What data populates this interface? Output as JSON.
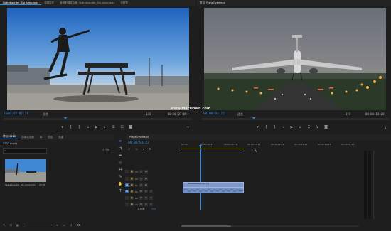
{
  "source_monitor": {
    "tabs": [
      "Skateboarder_Big_Jump.mov",
      "效果控件",
      "音频剪辑混合器: Skateboarder_Big_Jump.mov",
      "元数据"
    ],
    "timecode_left": "1&nbsp;00:02:01:28",
    "timecode_left_text": "1&00:02:01:28",
    "fit": "适合",
    "fraction": "1/2",
    "timecode_right": "00:00:27:08"
  },
  "program_monitor": {
    "tab": "节目: PlaneOverhead",
    "timecode_left": "00:00:03:22",
    "fit": "适合",
    "fraction": "1/2",
    "timecode_right": "00:00:12:20",
    "watermark": "www.MacDown.com"
  },
  "project_panel": {
    "tabs": [
      "项目: 2222",
      "媒体浏览器",
      "库",
      "信息",
      "效果"
    ],
    "subtab": "2222.prproj",
    "count": "1 个项",
    "clip_name": "Skateboarder_Big_Jump.mov",
    "clip_duration": "27:08"
  },
  "timeline": {
    "tab": "PlaneOverhead",
    "timecode": "00:00:03:22",
    "ruler": [
      "00:00",
      "00:00:04:23",
      "00:00:09:23",
      "00:00:14:23",
      "00:00:19:23",
      "00:00:24:23",
      "00:00:29:23",
      "00:00:34:23"
    ],
    "tracks": [
      "V3",
      "V2",
      "V1",
      "A1",
      "A2",
      "A3"
    ],
    "master_label": "主声道",
    "master_value": "0.0",
    "clip_video": "PlaneOverhead.mov [V]",
    "clip_audio": ""
  },
  "icons": [
    "play-icon",
    "step-back-icon",
    "step-forward-icon",
    "marker-icon",
    "camera-icon",
    "wrench-icon",
    "search-icon",
    "pen-icon",
    "hand-icon",
    "text-icon"
  ]
}
